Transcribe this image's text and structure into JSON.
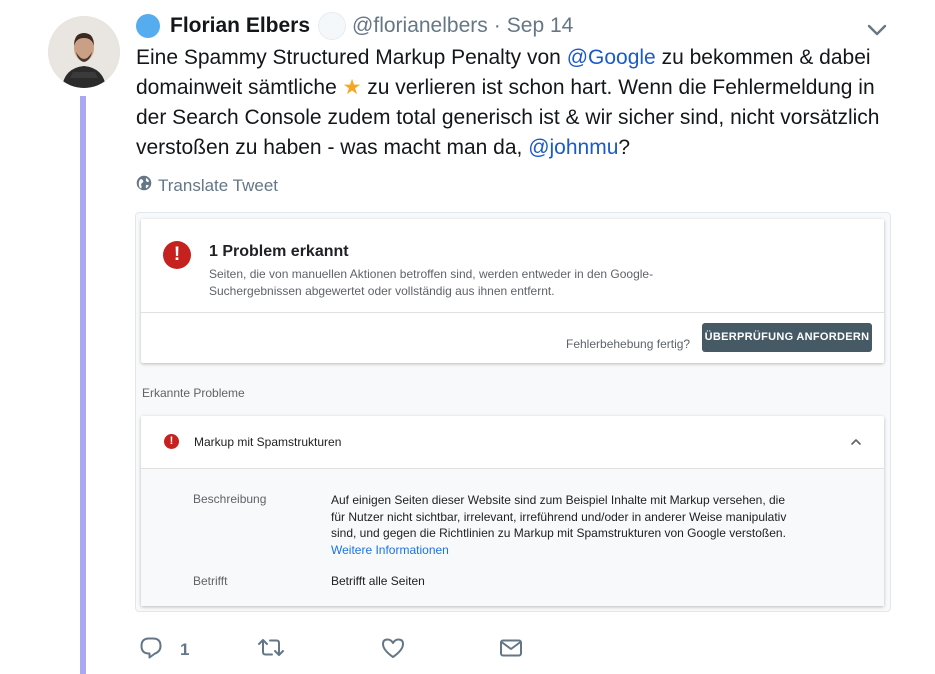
{
  "tweet": {
    "author_name": "Florian Elbers",
    "handle": "@florianelbers",
    "separator": "·",
    "date": "Sep 14",
    "text_1": "Eine Spammy Structured Markup Penalty von ",
    "mention_1": "@Google",
    "text_2": " zu bekommen & dabei domainweit sämtliche ",
    "star_emoji": "★",
    "text_3": " zu verlieren ist schon hart. Wenn die Fehlermeldung in der Search Console zudem total generisch ist & wir sicher sind, nicht vorsätzlich verstoßen zu haben - was macht man da, ",
    "mention_2": "@johnmu",
    "text_4": "?",
    "translate_label": "Translate Tweet"
  },
  "embedded_screenshot": {
    "problem_title": "1 Problem erkannt",
    "problem_description": "Seiten, die von manuellen Aktionen betroffen sind, werden entweder in den Google-Suchergebnissen abgewertet oder vollständig aus ihnen entfernt.",
    "fix_question": "Fehlerbehebung fertig?",
    "review_button": "ÜBERPRÜFUNG ANFORDERN",
    "issues_heading": "Erkannte Probleme",
    "issue_label": "Markup mit Spamstrukturen",
    "description_label": "Beschreibung",
    "description_text": "Auf einigen Seiten dieser Website sind zum Beispiel Inhalte mit Markup versehen, die für Nutzer nicht sichtbar, irrelevant, irreführend und/oder in anderer Weise manipulativ sind, und gegen die Richtlinien zu Markup mit Spamstrukturen von Google verstoßen.",
    "more_info_link": "Weitere Informationen",
    "affected_label": "Betrifft",
    "affected_text": "Betrifft alle Seiten"
  },
  "actions": {
    "reply_count": "1"
  },
  "icons": {
    "reply": "reply-icon",
    "retweet": "retweet-icon",
    "like": "heart-icon",
    "dm": "envelope-icon",
    "translate": "globe-icon",
    "menu": "chevron-down-icon",
    "error": "error-icon",
    "collapse": "chevron-up-icon"
  },
  "colors": {
    "thread_line": "#a9a8f2",
    "link_blue": "#1b5ac9",
    "error_red": "#c5221f",
    "button_slate": "#455a64",
    "muted_text": "#657786"
  }
}
